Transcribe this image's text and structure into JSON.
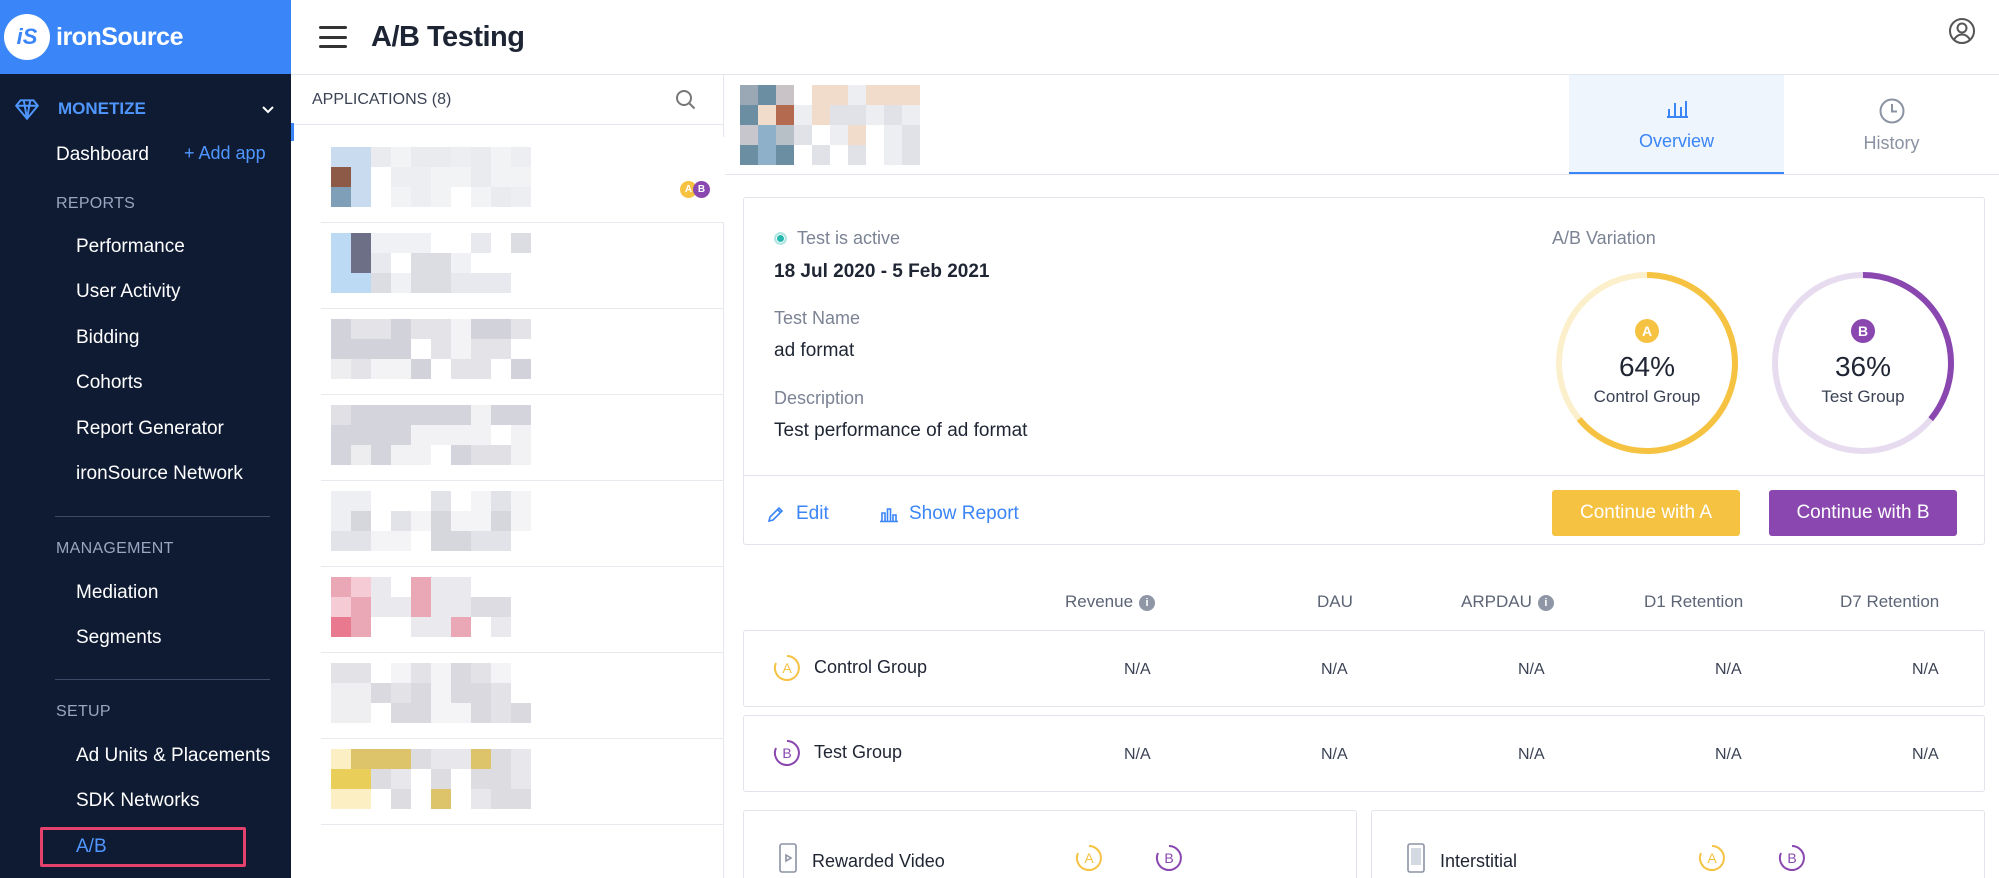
{
  "brand": {
    "logo_text": "iS",
    "name": "ironSource"
  },
  "header": {
    "title": "A/B Testing"
  },
  "sidebar": {
    "monetize_label": "MONETIZE",
    "dashboard": "Dashboard",
    "add_app": "+ Add app",
    "reports_label": "REPORTS",
    "reports": [
      "Performance",
      "User Activity",
      "Bidding",
      "Cohorts",
      "Report Generator",
      "ironSource Network"
    ],
    "management_label": "MANAGEMENT",
    "management": [
      "Mediation",
      "Segments"
    ],
    "setup_label": "SETUP",
    "setup": [
      "Ad Units & Placements",
      "SDK Networks",
      "A/B"
    ]
  },
  "applications": {
    "header": "APPLICATIONS (8)",
    "count": 8
  },
  "tabs": [
    {
      "label": "Overview",
      "active": true
    },
    {
      "label": "History",
      "active": false
    }
  ],
  "test": {
    "status": "Test is active",
    "dates": "18 Jul 2020 - 5 Feb 2021",
    "name_label": "Test Name",
    "name": "ad format",
    "description_label": "Description",
    "description": "Test performance of ad format",
    "variation_label": "A/B Variation",
    "group_a": {
      "badge": "A",
      "percent": "64%",
      "value": 0.64,
      "name": "Control Group",
      "color": "#f5c242"
    },
    "group_b": {
      "badge": "B",
      "percent": "36%",
      "value": 0.36,
      "name": "Test Group",
      "color": "#8a47b0"
    }
  },
  "actions": {
    "edit": "Edit",
    "show_report": "Show Report",
    "continue_a": "Continue with A",
    "continue_b": "Continue with B"
  },
  "metrics": {
    "headers": [
      "Revenue",
      "DAU",
      "ARPDAU",
      "D1 Retention",
      "D7 Retention"
    ],
    "rows": [
      {
        "badge": "A",
        "group": "Control Group",
        "values": [
          "N/A",
          "N/A",
          "N/A",
          "N/A",
          "N/A"
        ]
      },
      {
        "badge": "B",
        "group": "Test Group",
        "values": [
          "N/A",
          "N/A",
          "N/A",
          "N/A",
          "N/A"
        ]
      }
    ]
  },
  "ad_units": [
    {
      "name": "Rewarded Video",
      "icon": "phone-icon"
    },
    {
      "name": "Interstitial",
      "icon": "phone-icon"
    }
  ],
  "colors": {
    "brand": "#3a85f7",
    "sidebar": "#0f1b33",
    "group_a": "#f5c242",
    "group_b": "#8a47b0",
    "highlight": "#e4416d"
  }
}
